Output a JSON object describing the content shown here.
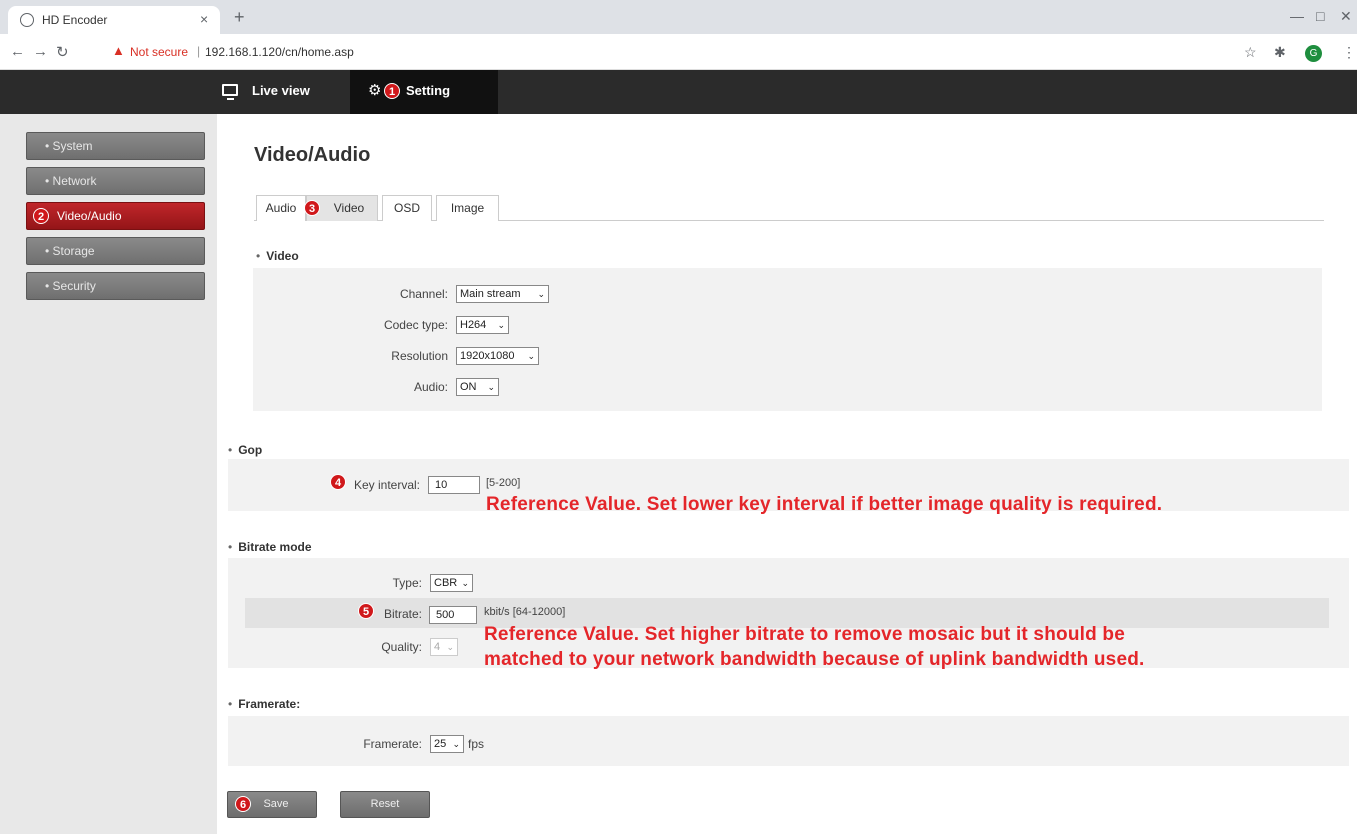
{
  "browser": {
    "tab_title": "HD Encoder",
    "tab_close": "×",
    "new_tab": "+",
    "not_secure": "Not secure",
    "url": "192.168.1.120/cn/home.asp",
    "profile_initial": "G"
  },
  "header": {
    "live_view": "Live view",
    "setting": "Setting"
  },
  "badges": {
    "b1": "1",
    "b2": "2",
    "b3": "3",
    "b4": "4",
    "b5": "5",
    "b6": "6"
  },
  "sidebar": {
    "items": [
      {
        "label": "System"
      },
      {
        "label": "Network"
      },
      {
        "label": "Video/Audio",
        "active": true
      },
      {
        "label": "Storage"
      },
      {
        "label": "Security"
      }
    ]
  },
  "page": {
    "title": "Video/Audio",
    "tabs": [
      {
        "label": "Audio"
      },
      {
        "label": "Video",
        "active": true
      },
      {
        "label": "OSD"
      },
      {
        "label": "Image"
      }
    ]
  },
  "video": {
    "section": "Video",
    "channel_label": "Channel:",
    "channel_value": "Main stream",
    "codec_label": "Codec type:",
    "codec_value": "H264",
    "resolution_label": "Resolution",
    "resolution_value": "1920x1080",
    "audio_label": "Audio:",
    "audio_value": "ON"
  },
  "gop": {
    "section": "Gop",
    "key_label": "Key interval:",
    "key_value": "10",
    "key_range": "[5-200]",
    "annotation": "Reference Value. Set lower key interval if better image quality is required."
  },
  "bitrate": {
    "section": "Bitrate mode",
    "type_label": "Type:",
    "type_value": "CBR",
    "bitrate_label": "Bitrate:",
    "bitrate_value": "500",
    "bitrate_range": "kbit/s [64-12000]",
    "quality_label": "Quality:",
    "quality_value": "4",
    "annotation_line1": "Reference Value. Set higher bitrate to remove mosaic but it should be",
    "annotation_line2": "matched to your network bandwidth because of uplink bandwidth used."
  },
  "framerate": {
    "section": "Framerate:",
    "label": "Framerate:",
    "value": "25",
    "unit": "fps"
  },
  "actions": {
    "save": "Save",
    "reset": "Reset"
  },
  "colors": {
    "accent_red": "#c0262a",
    "annotation_red": "#e4262a",
    "header_dark": "#2b2b2b"
  }
}
